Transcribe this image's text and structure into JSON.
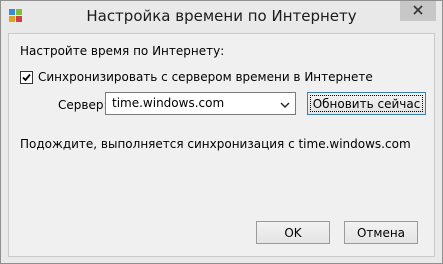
{
  "window": {
    "title": "Настройка времени по Интернету"
  },
  "icons": {
    "app": "clock-globe-icon",
    "close": "close-icon",
    "dropdown": "chevron-down-icon",
    "checkmark": "checkmark-icon"
  },
  "settings": {
    "header": "Настройте время по Интернету:",
    "sync_checkbox_label": "Синхронизировать с сервером времени в Интернете",
    "sync_checked": true,
    "server_label": "Сервер:",
    "server_value": "time.windows.com",
    "update_now_label": "Обновить сейчас",
    "status": "Подождите, выполняется синхронизация с time.windows.com"
  },
  "buttons": {
    "ok": "OK",
    "cancel": "Отмена"
  },
  "colors": {
    "close_button_bg": "#c7c7c7",
    "focus_border": "#3c7fb1"
  }
}
